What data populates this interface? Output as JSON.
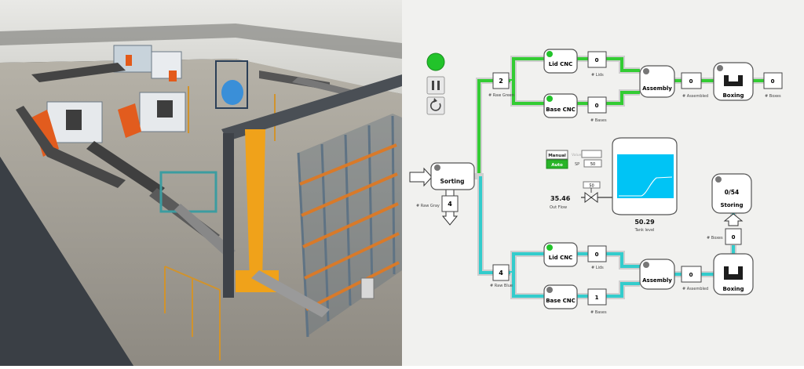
{
  "controls": {
    "run_indicator_color": "#22c32a",
    "pause_icon": "pause-icon",
    "reset_icon": "reset-icon"
  },
  "colors": {
    "green_pipe": "#33cc33",
    "blue_pipe": "#33cccc",
    "gray_pipe": "#cfcfcf",
    "tank_fill": "#00c4f5",
    "auto_button": "#28b428",
    "status_led_green": "#22c32a",
    "status_led_gray": "#777777"
  },
  "sorting": {
    "label": "Sorting",
    "counter": "4",
    "counter_caption": "# Raw Gray"
  },
  "top": {
    "raw_counter": "2",
    "raw_caption": "# Raw Green",
    "lid_cnc": {
      "label": "Lid CNC",
      "count": "0",
      "caption": "# Lids",
      "status": "green"
    },
    "base_cnc": {
      "label": "Base CNC",
      "count": "0",
      "caption": "# Bases",
      "status": "green"
    },
    "assembly": {
      "label": "Assembly",
      "count": "0",
      "caption": "# Assembled",
      "status": "gray"
    },
    "boxing": {
      "label": "Boxing",
      "count": "0",
      "caption": "# Boxes",
      "status": "gray"
    }
  },
  "bottom": {
    "raw_counter": "4",
    "raw_caption": "# Raw Blue",
    "lid_cnc": {
      "label": "Lid CNC",
      "count": "0",
      "caption": "# Lids",
      "status": "green"
    },
    "base_cnc": {
      "label": "Base CNC",
      "count": "1",
      "caption": "# Bases",
      "status": "gray"
    },
    "assembly": {
      "label": "Assembly",
      "count": "0",
      "caption": "# Assembled",
      "status": "gray"
    },
    "boxing": {
      "label": "Boxing",
      "count": "0",
      "caption": "# Boxes",
      "status": "gray"
    }
  },
  "storing": {
    "label": "Storing",
    "value": "0/54"
  },
  "tank": {
    "mode_manual": "Manual",
    "mode_auto": "Auto",
    "value_label": "Value",
    "value": "",
    "sp_label": "SP",
    "sp_value": "50",
    "valve_value": "50",
    "outflow_value": "35.46",
    "outflow_label": "Out Flow",
    "level_value": "50.29",
    "level_label": "Tank level"
  }
}
